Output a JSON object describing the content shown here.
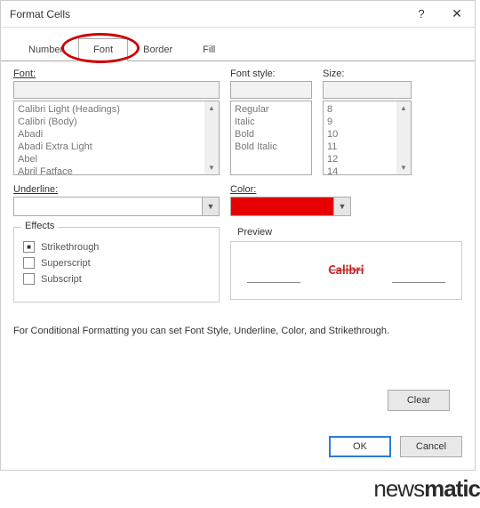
{
  "titlebar": {
    "title": "Format Cells",
    "help": "?",
    "close": "✕"
  },
  "tabs": {
    "number": "Number",
    "font": "Font",
    "border": "Border",
    "fill": "Fill"
  },
  "labels": {
    "font": "Font:",
    "style": "Font style:",
    "size": "Size:",
    "underline": "Underline:",
    "color": "Color:",
    "effects": "Effects",
    "preview": "Preview"
  },
  "fontList": {
    "i0": "Calibri Light (Headings)",
    "i1": "Calibri (Body)",
    "i2": "Abadi",
    "i3": "Abadi Extra Light",
    "i4": "Abel",
    "i5": "Abril Fatface"
  },
  "styleList": {
    "i0": "Regular",
    "i1": "Italic",
    "i2": "Bold",
    "i3": "Bold Italic"
  },
  "sizeList": {
    "i0": "8",
    "i1": "9",
    "i2": "10",
    "i3": "11",
    "i4": "12",
    "i5": "14"
  },
  "effects": {
    "strike": "Strikethrough",
    "super": "Superscript",
    "sub": "Subscript"
  },
  "preview": {
    "text": "Calibri"
  },
  "note": "For Conditional Formatting you can set Font Style, Underline, Color, and Strikethrough.",
  "buttons": {
    "clear": "Clear",
    "ok": "OK",
    "cancel": "Cancel"
  },
  "watermark": {
    "a": "news",
    "b": "matic"
  },
  "colors": {
    "preview_text": "#c62828",
    "swatch": "#e60000"
  }
}
